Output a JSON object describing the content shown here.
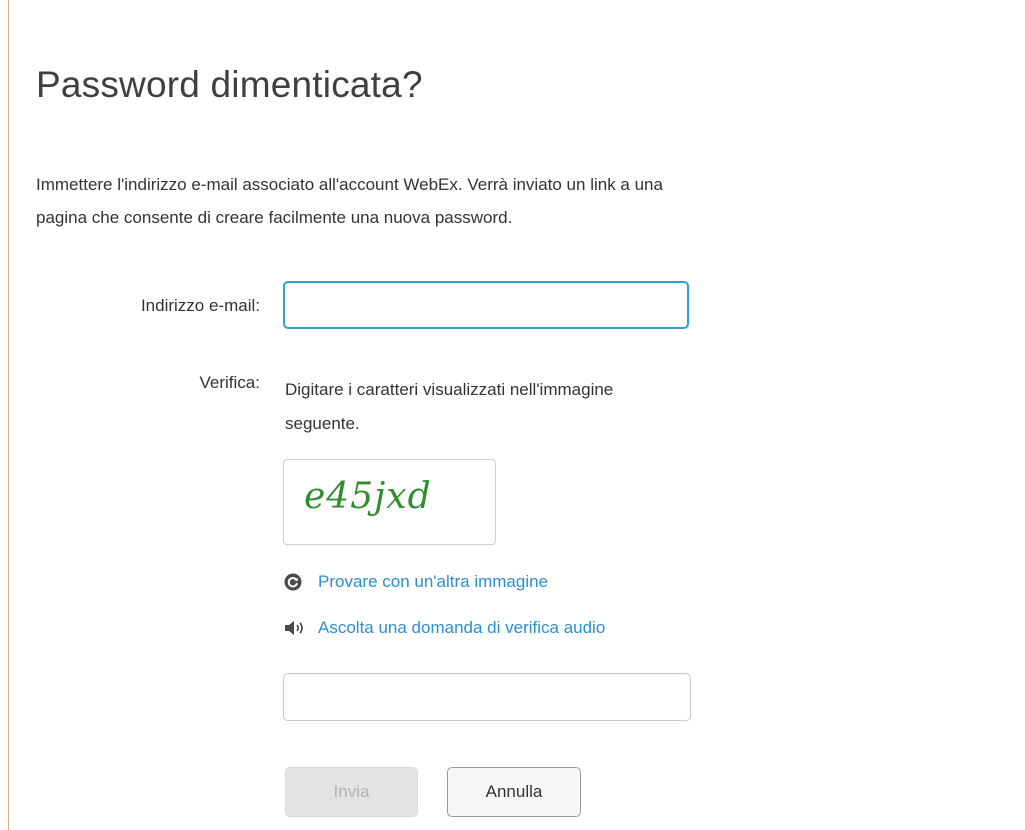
{
  "page": {
    "title": "Password dimenticata?",
    "intro_line1": "Immettere l'indirizzo e-mail associato all'account WebEx. Verrà inviato un link a una",
    "intro_line2": "pagina che consente di creare facilmente una nuova password."
  },
  "form": {
    "email_label": "Indirizzo e-mail:",
    "email_value": "",
    "email_placeholder": "",
    "verify_label": "Verifica:",
    "verify_instruction_line1": "Digitare i caratteri visualizzati nell'immagine",
    "verify_instruction_line2": "seguente.",
    "captcha_text": "e45jxd",
    "captcha_value": "",
    "captcha_placeholder": ""
  },
  "links": {
    "refresh_icon": "refresh-icon",
    "refresh_label": "Provare con un'altra immagine",
    "audio_icon": "speaker-icon",
    "audio_label": "Ascolta una domanda di verifica audio"
  },
  "buttons": {
    "send_label": "Invia",
    "send_disabled": true,
    "cancel_label": "Annulla"
  },
  "colors": {
    "accent_link": "#2b8fd0",
    "focus_border": "#2b9fd6",
    "captcha_green": "#2f8f2f",
    "left_border": "#e6a77a"
  }
}
